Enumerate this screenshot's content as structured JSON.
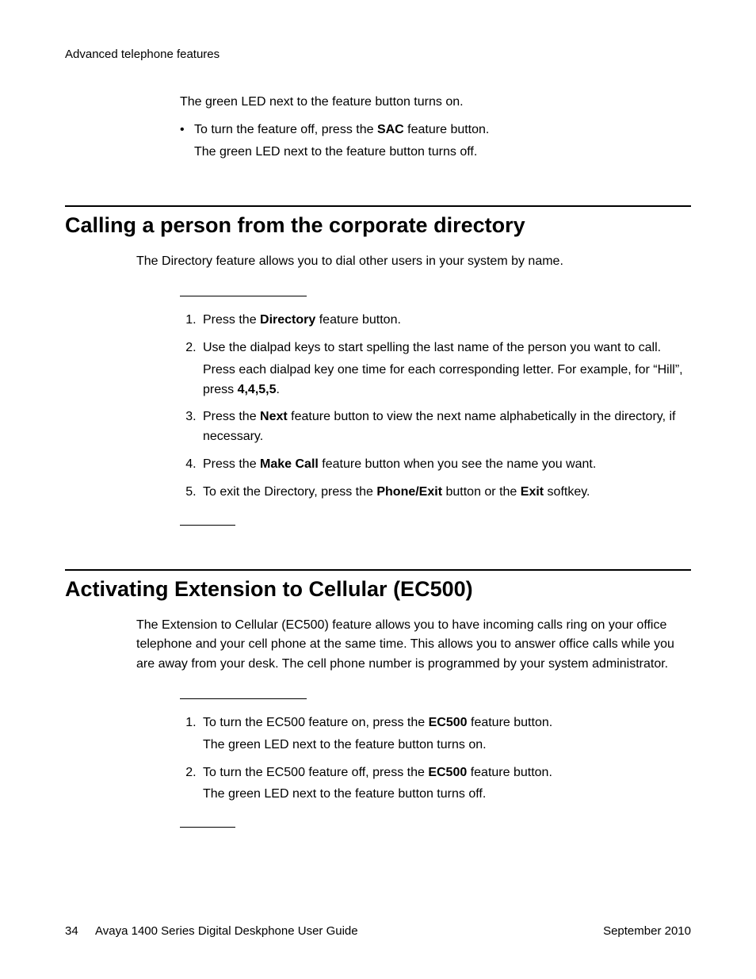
{
  "running_head": "Advanced telephone features",
  "top_fragment": {
    "cont_line": "The green LED next to the feature button turns on.",
    "bullet_pre": "To turn the feature off, press the ",
    "bullet_bold": "SAC",
    "bullet_post": " feature button.",
    "bullet_sub": "The green LED next to the feature button turns off."
  },
  "section1": {
    "title": "Calling a person from the corporate directory",
    "intro": "The Directory feature allows you to dial other users in your system by name.",
    "steps": {
      "s1_pre": "Press the ",
      "s1_b1": "Directory",
      "s1_post": " feature button.",
      "s2_line1": "Use the dialpad keys to start spelling the last name of the person you want to call.",
      "s2_line2_pre": "Press each dialpad key one time for each corresponding letter. For example, for “Hill”, press ",
      "s2_b": "4,4,5,5",
      "s2_post": ".",
      "s3_pre": "Press the ",
      "s3_b": "Next",
      "s3_post": " feature button to view the next name alphabetically in the directory, if necessary.",
      "s4_pre": "Press the ",
      "s4_b": "Make Call",
      "s4_post": " feature button when you see the name you want.",
      "s5_pre": "To exit the Directory, press the ",
      "s5_b1": "Phone/Exit",
      "s5_mid": " button or the ",
      "s5_b2": "Exit",
      "s5_post": " softkey."
    }
  },
  "section2": {
    "title": "Activating Extension to Cellular (EC500)",
    "intro": "The Extension to Cellular (EC500) feature allows you to have incoming calls ring on your office telephone and your cell phone at the same time. This allows you to answer office calls while you are away from your desk. The cell phone number is programmed by your system administrator.",
    "steps": {
      "s1_pre": "To turn the EC500 feature on, press the ",
      "s1_b": "EC500",
      "s1_post": " feature button.",
      "s1_sub": "The green LED next to the feature button turns on.",
      "s2_pre": "To turn the EC500 feature off, press the ",
      "s2_b": "EC500",
      "s2_post": " feature button.",
      "s2_sub": "The green LED next to the feature button turns off."
    }
  },
  "footer": {
    "page": "34",
    "doc": "Avaya 1400 Series Digital Deskphone User Guide",
    "date": "September 2010"
  }
}
